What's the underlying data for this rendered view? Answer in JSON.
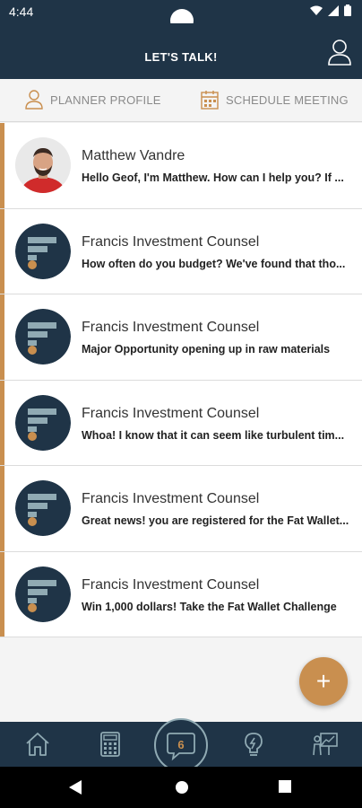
{
  "status_bar": {
    "time": "4:44"
  },
  "header": {
    "title": "LET'S TALK!"
  },
  "actions": {
    "planner_profile": "PLANNER PROFILE",
    "schedule_meeting": "SCHEDULE MEETING"
  },
  "conversations": [
    {
      "name": "Matthew Vandre",
      "preview": "Hello Geof, I'm Matthew. How can I help you? If ...",
      "avatar": "person-photo"
    },
    {
      "name": "Francis Investment Counsel",
      "preview": "How often do you budget? We've found that tho...",
      "avatar": "fic-logo"
    },
    {
      "name": "Francis Investment Counsel",
      "preview": "Major Opportunity opening up in raw materials",
      "avatar": "fic-logo"
    },
    {
      "name": "Francis Investment Counsel",
      "preview": "Whoa! I know that it can seem like turbulent tim...",
      "avatar": "fic-logo"
    },
    {
      "name": "Francis Investment Counsel",
      "preview": "Great news! you are registered for the Fat Wallet...",
      "avatar": "fic-logo"
    },
    {
      "name": "Francis Investment Counsel",
      "preview": "Win 1,000 dollars! Take the Fat Wallet Challenge",
      "avatar": "fic-logo"
    }
  ],
  "fab": {
    "label": "+"
  },
  "bottom_nav": {
    "items": [
      "home-icon",
      "calculator-icon",
      "chat-icon",
      "lightbulb-icon",
      "presentation-icon"
    ],
    "chat_badge": "6"
  },
  "colors": {
    "navy": "#1f3447",
    "accent": "#c98f4f",
    "logo_bar": "#90aab3"
  }
}
